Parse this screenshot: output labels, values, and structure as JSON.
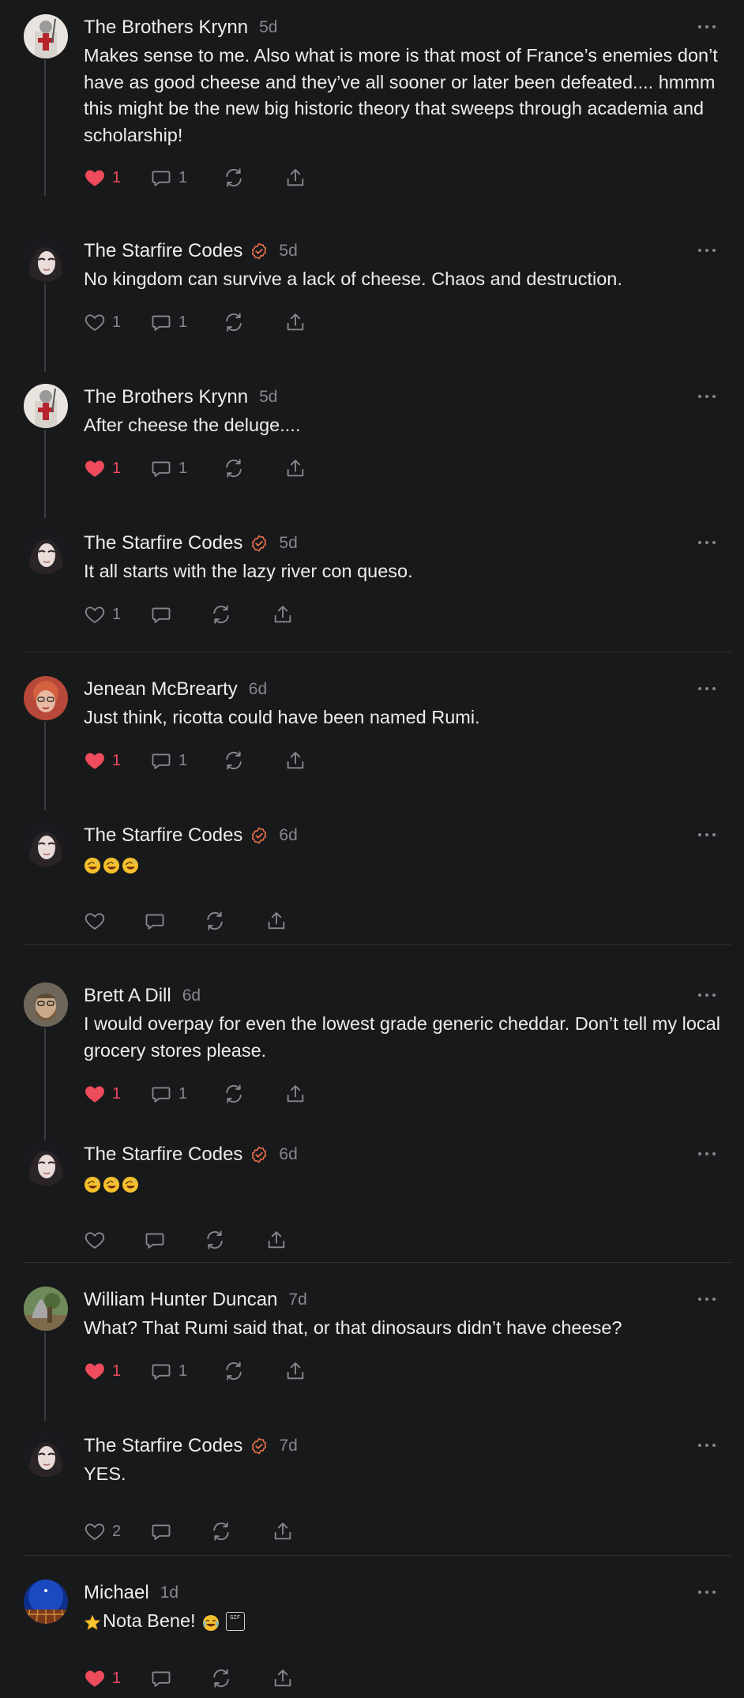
{
  "colors": {
    "background": "#18191b",
    "text": "#ecedee",
    "muted": "#86888c",
    "like_active": "#ee4b5c",
    "verified": "#e8724a",
    "divider": "#2e2f32",
    "thread_line": "#3a3b3e"
  },
  "icons": {
    "like": "heart-icon",
    "reply": "comment-bubble-icon",
    "restack": "restack-icon",
    "share": "share-icon",
    "more": "more-dots-icon",
    "verified": "verified-check-icon"
  },
  "comments": [
    {
      "author": "The Brothers Krynn",
      "time": "5d",
      "verified": false,
      "text": "Makes sense to me. Also what is more is that most of France’s enemies don’t have as good cheese and they’ve all sooner or later been defeated.... hmmm this might be the new big historic theory that sweeps through academia and scholarship!",
      "likes": "1",
      "liked": true,
      "replies": "1"
    },
    {
      "author": "The Starfire Codes",
      "time": "5d",
      "verified": true,
      "text": "No kingdom can survive a lack of cheese. Chaos and destruction.",
      "likes": "1",
      "liked": false,
      "replies": "1"
    },
    {
      "author": "The Brothers Krynn",
      "time": "5d",
      "verified": false,
      "text": "After cheese the deluge....",
      "likes": "1",
      "liked": true,
      "replies": "1"
    },
    {
      "author": "The Starfire Codes",
      "time": "5d",
      "verified": true,
      "text": "It all starts with the lazy river con queso.",
      "likes": "1",
      "liked": false,
      "replies": ""
    },
    {
      "author": "Jenean McBrearty",
      "time": "6d",
      "verified": false,
      "text": "Just think, ricotta could have been named Rumi.",
      "likes": "1",
      "liked": true,
      "replies": "1"
    },
    {
      "author": "The Starfire Codes",
      "time": "6d",
      "verified": true,
      "text": "",
      "emoji": "rolling-on-floor-laughing x3",
      "likes": "",
      "liked": false,
      "replies": ""
    },
    {
      "author": "Brett A Dill",
      "time": "6d",
      "verified": false,
      "text": "I would overpay for even the lowest grade generic cheddar. Don’t tell my local grocery stores please.",
      "likes": "1",
      "liked": true,
      "replies": "1"
    },
    {
      "author": "The Starfire Codes",
      "time": "6d",
      "verified": true,
      "text": "",
      "emoji": "rolling-on-floor-laughing x3",
      "likes": "",
      "liked": false,
      "replies": ""
    },
    {
      "author": "William Hunter Duncan",
      "time": "7d",
      "verified": false,
      "text": "What? That Rumi said that, or that dinosaurs didn’t have cheese?",
      "likes": "1",
      "liked": true,
      "replies": "1"
    },
    {
      "author": "The Starfire Codes",
      "time": "7d",
      "verified": true,
      "text": "YES.",
      "likes": "2",
      "liked": false,
      "replies": ""
    },
    {
      "author": "Michael",
      "time": "1d",
      "verified": false,
      "text": "Nota Bene!",
      "gif_label": "GIF",
      "likes": "1",
      "liked": true,
      "replies": ""
    }
  ]
}
